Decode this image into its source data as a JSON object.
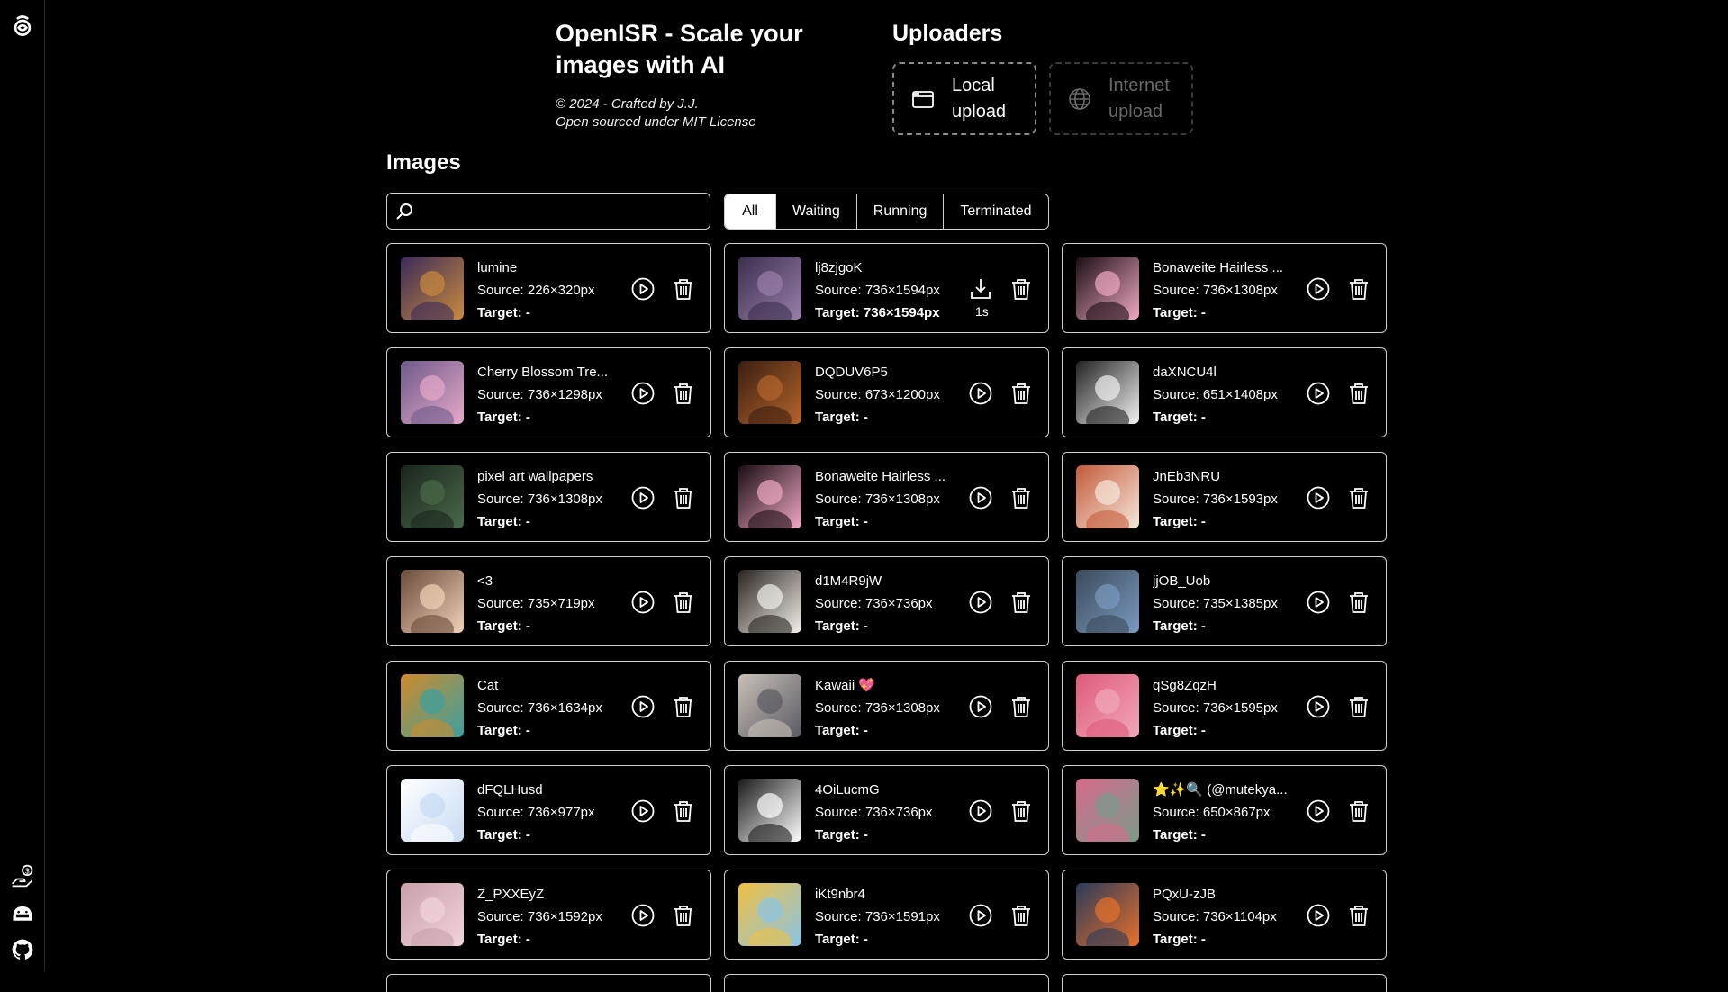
{
  "header": {
    "title": "OpenISR - Scale your images with AI",
    "credit_line1": "© 2024 - Crafted by J.J.",
    "credit_line2": "Open sourced under MIT License"
  },
  "uploaders": {
    "title": "Uploaders",
    "local_label": "Local upload",
    "internet_label": "Internet upload"
  },
  "images": {
    "title": "Images",
    "search_value": "",
    "tabs": [
      "All",
      "Waiting",
      "Running",
      "Terminated"
    ],
    "active_tab": "All"
  },
  "cards": [
    {
      "name": "lumine",
      "source": "Source: 226×320px",
      "target": "Target: -",
      "status": "waiting",
      "thumb_color": "#c98a3d",
      "thumb_color2": "#3b2a5a"
    },
    {
      "name": "lj8zjgoK",
      "source": "Source: 736×1594px",
      "target": "Target: 736×1594px",
      "status": "done",
      "time": "1s",
      "thumb_color": "#9a7fa8",
      "thumb_color2": "#3a2f4f"
    },
    {
      "name": "Bonaweite Hairless ...",
      "source": "Source: 736×1308px",
      "target": "Target: -",
      "status": "waiting",
      "thumb_color": "#f0a8c4",
      "thumb_color2": "#1a0d14"
    },
    {
      "name": "Cherry Blossom Tre...",
      "source": "Source: 736×1298px",
      "target": "Target: -",
      "status": "waiting",
      "thumb_color": "#e6a9c9",
      "thumb_color2": "#6e5a8a"
    },
    {
      "name": "DQDUV6P5",
      "source": "Source: 673×1200px",
      "target": "Target: -",
      "status": "waiting",
      "thumb_color": "#b5652c",
      "thumb_color2": "#3a1e10"
    },
    {
      "name": "daXNCU4l",
      "source": "Source: 651×1408px",
      "target": "Target: -",
      "status": "waiting",
      "thumb_color": "#f2f2f2",
      "thumb_color2": "#222222"
    },
    {
      "name": "pixel art wallpapers",
      "source": "Source: 736×1308px",
      "target": "Target: -",
      "status": "waiting",
      "thumb_color": "#4a6a4a",
      "thumb_color2": "#1a241c"
    },
    {
      "name": "Bonaweite Hairless ...",
      "source": "Source: 736×1308px",
      "target": "Target: -",
      "status": "waiting",
      "thumb_color": "#f0a8c4",
      "thumb_color2": "#1a0d14"
    },
    {
      "name": "JnEb3NRU",
      "source": "Source: 736×1593px",
      "target": "Target: -",
      "status": "waiting",
      "thumb_color": "#f6e8dc",
      "thumb_color2": "#c45a3a"
    },
    {
      "name": "<3",
      "source": "Source: 735×719px",
      "target": "Target: -",
      "status": "waiting",
      "thumb_color": "#f2d2b8",
      "thumb_color2": "#6a4a3a"
    },
    {
      "name": "d1M4R9jW",
      "source": "Source: 736×736px",
      "target": "Target: -",
      "status": "waiting",
      "thumb_color": "#f4f0ea",
      "thumb_color2": "#2a2420"
    },
    {
      "name": "jjOB_Uob",
      "source": "Source: 735×1385px",
      "target": "Target: -",
      "status": "waiting",
      "thumb_color": "#7a9ac0",
      "thumb_color2": "#3a4a5a"
    },
    {
      "name": "Cat",
      "source": "Source: 736×1634px",
      "target": "Target: -",
      "status": "waiting",
      "thumb_color": "#3aa0a0",
      "thumb_color2": "#d08a2a"
    },
    {
      "name": "Kawaii 💖",
      "source": "Source: 736×1308px",
      "target": "Target: -",
      "status": "waiting",
      "thumb_color": "#5a5a62",
      "thumb_color2": "#c8c0b8"
    },
    {
      "name": "qSg8ZqzH",
      "source": "Source: 736×1595px",
      "target": "Target: -",
      "status": "waiting",
      "thumb_color": "#f0a8b8",
      "thumb_color2": "#e05a7a"
    },
    {
      "name": "dFQLHusd",
      "source": "Source: 736×977px",
      "target": "Target: -",
      "status": "waiting",
      "thumb_color": "#c8dcf4",
      "thumb_color2": "#ffffff"
    },
    {
      "name": "4OiLucmG",
      "source": "Source: 736×736px",
      "target": "Target: -",
      "status": "waiting",
      "thumb_color": "#ffffff",
      "thumb_color2": "#1a1a1a"
    },
    {
      "name": "⭐✨🔍 (@mutekya...",
      "source": "Source: 650×867px",
      "target": "Target: -",
      "status": "waiting",
      "thumb_color": "#7a9a8a",
      "thumb_color2": "#d86a8a"
    },
    {
      "name": "Z_PXXEyZ",
      "source": "Source: 736×1592px",
      "target": "Target: -",
      "status": "waiting",
      "thumb_color": "#f2d4dc",
      "thumb_color2": "#c8a0a8"
    },
    {
      "name": "iKt9nbr4",
      "source": "Source: 736×1591px",
      "target": "Target: -",
      "status": "waiting",
      "thumb_color": "#8ac4e8",
      "thumb_color2": "#f0c040"
    },
    {
      "name": "PQxU-zJB",
      "source": "Source: 736×1104px",
      "target": "Target: -",
      "status": "waiting",
      "thumb_color": "#e8702a",
      "thumb_color2": "#2a3a5a"
    }
  ],
  "sidebar": {
    "logo_icon": "openisr-logo-icon",
    "bottom_icons": [
      "donate-icon",
      "ollama-icon",
      "github-icon"
    ]
  }
}
